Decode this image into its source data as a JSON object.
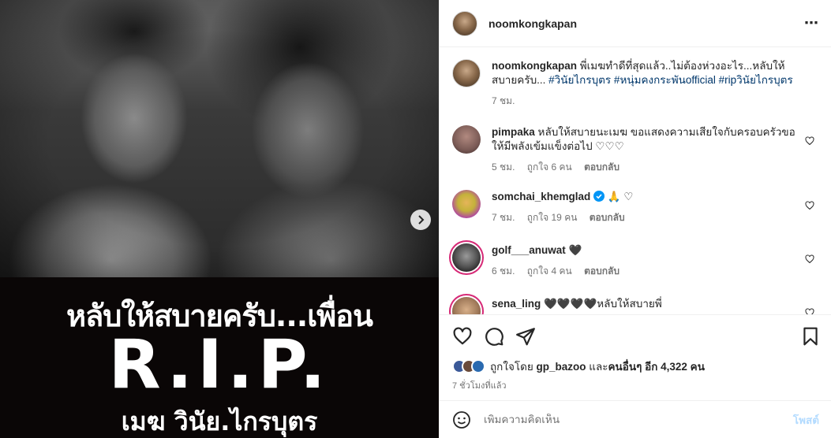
{
  "post": {
    "author": "noomkongkapan",
    "more_icon": "⋯",
    "image_text": {
      "line1": "หลับให้สบายครับ...เพื่อน",
      "rip": "R.I.P.",
      "name": "เมฆ วินัย.ไกรบุตร"
    }
  },
  "caption": {
    "user": "noomkongkapan",
    "text": "พี่เมฆทำดีที่สุดแล้ว..ไม่ต้องห่วงอะไร...หลับให้สบายครับ... ",
    "tags": "#วินัยไกรบุตร #หนุ่มคงกระพันofficial #ripวินัยไกรบุตร",
    "time": "7 ชม."
  },
  "comments": [
    {
      "user": "pimpaka",
      "text": "หลับให้สบายนะเมฆ ขอแสดงความเสียใจกับครอบครัวขอให้มีพลังเข้มแข็งต่อไป ♡♡♡",
      "time": "5 ชม.",
      "likes": "ถูกใจ 6 คน",
      "reply": "ตอบกลับ",
      "avatar_color": "#7a5a55"
    },
    {
      "user": "somchai_khemglad",
      "text": "🙏 ♡",
      "time": "7 ชม.",
      "likes": "ถูกใจ 19 คน",
      "reply": "ตอบกลับ",
      "avatar_color": "#c4b23a"
    },
    {
      "user": "golf___anuwat",
      "text": "🖤",
      "time": "6 ชม.",
      "likes": "ถูกใจ 4 คน",
      "reply": "ตอบกลับ",
      "avatar_color": "#555555"
    },
    {
      "user": "sena_ling",
      "text": "🖤🖤🖤🖤หลับให้สบายพี่",
      "time": "",
      "likes": "",
      "reply": "",
      "avatar_color": "#a07a5a"
    }
  ],
  "likes": {
    "prefix": "ถูกใจโดย ",
    "user": "gp_bazoo",
    "middle": " และ",
    "others": "คนอื่นๆ อีก 4,322 คน"
  },
  "posted_time": "7 ชั่วโมงที่แล้ว",
  "add_comment": {
    "placeholder": "เพิ่มความคิดเห็น",
    "post_label": "โพสต์"
  },
  "colors": {
    "link": "#00376b",
    "muted": "#737373",
    "verified": "#0095f6",
    "post_disabled": "#b3dbff"
  }
}
